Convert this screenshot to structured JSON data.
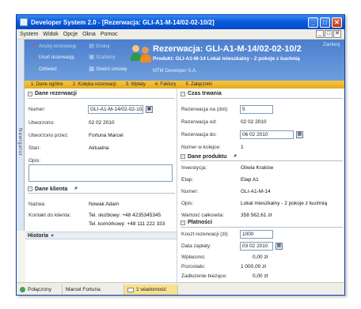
{
  "window": {
    "title": "Developer System 2.0 - [Rezerwacja: GLI-A1-M-14/02-02-10/2]",
    "controls": [
      "_",
      "□",
      "✕"
    ]
  },
  "menu": {
    "items": [
      "System",
      "Widok",
      "Opcje",
      "Okna",
      "Pomoc"
    ],
    "mdi_controls": [
      "_",
      "□",
      "✕"
    ]
  },
  "toolbar": {
    "anuluj": "Anuluj rezerwację",
    "drukuj": "Drukuj",
    "usun": "Usuń rezerwację",
    "szablony": "Szablony",
    "odswiez": "Odśwież",
    "stworz_umowe": "Stwórz umowę"
  },
  "header": {
    "title": "Rezerwacja: GLI-A1-M-14/02-02-10/2",
    "subtitle": "Produkt: GLI-A1-M-14 Lokal mieszkalny - 2 pokoje z kuchnią",
    "developer": "MTM Developer S.A.",
    "close_label": "Zamknij"
  },
  "navigator_label": "Nawigator",
  "steps": [
    "1. Dane ogólne",
    "2. Kolejka rezerwacji",
    "3. Wpłaty",
    "4. Faktury",
    "5. Załączniki"
  ],
  "dane_rezerwacji": {
    "title": "Dane rezerwacji",
    "numer_label": "Numer:",
    "numer_value": "GLI-A1-M-14/02-02-10/2",
    "utworzono_label": "Utworzono:",
    "utworzono_value": "02 02 2010",
    "utworzono_przez_label": "Utworzono przez:",
    "utworzono_przez_value": "Fortuna Marcel",
    "stan_label": "Stan:",
    "stan_value": "Aktualna",
    "opis_label": "Opis:"
  },
  "dane_klienta": {
    "title": "Dane klienta",
    "nazwa_label": "Nazwa:",
    "nazwa_value": "Nowak Adam",
    "kontakt_label": "Kontakt do klienta:",
    "tel_sluzbowy": "Tel. służbowy:   +48 4235345345",
    "tel_komorkowy": "Tel. komórkowy:  +48 111 222 333"
  },
  "historia": {
    "label": "Historia"
  },
  "czas_trwania": {
    "title": "Czas trwania",
    "rez_dni_label": "Rezerwacja na (dni):",
    "rez_dni_value": "5",
    "rez_od_label": "Rezerwacja od:",
    "rez_od_value": "02 02 2010",
    "rez_do_label": "Rezerwacja do:",
    "rez_do_value": "06 02 2010",
    "kolejka_label": "Numer w kolejce:",
    "kolejka_value": "1"
  },
  "dane_produktu": {
    "title": "Dane produktu",
    "inwestycja_label": "Inwestycja:",
    "inwestycja_value": "Gliwia Kraków",
    "etap_label": "Etap:",
    "etap_value": "Etap A1",
    "numer_label": "Numer:",
    "numer_value": "GLI-A1-M-14",
    "opis_label": "Opis:",
    "opis_value": "Lokal mieszkalny - 2 pokoje z kuchnią",
    "wartosc_label": "Wartość całkowita:",
    "wartosc_value": "358 562,61 zł"
  },
  "platnosci": {
    "title": "Płatności",
    "koszt_label": "Koszt rezerwacji (zł):",
    "koszt_value": "1000",
    "data_label": "Data zapłaty:",
    "data_value": "03 02 2010",
    "wplacono_label": "Wpłacono:",
    "wplacono_value": "0,00 zł",
    "pozostalo_label": "Pozostało:",
    "pozostalo_value": "1 000,00 zł",
    "zadluzenie_label": "Zadłużenie bieżące:",
    "zadluzenie_value": "0,00 zł"
  },
  "status": {
    "connection": "Połączony",
    "user": "Marcel Fortuna",
    "messages": "1 wiadomość"
  },
  "colors": {
    "header_blue": "#4b7fce",
    "title_blue": "#0a5cdc",
    "steps_yellow": "#f4c642"
  }
}
